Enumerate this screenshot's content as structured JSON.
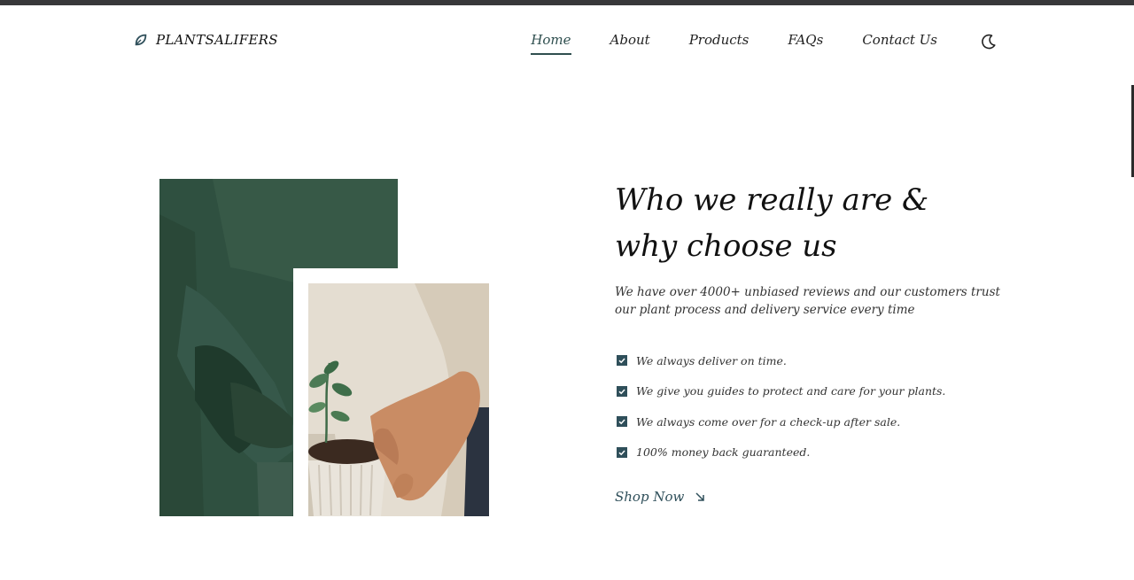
{
  "brand": {
    "name": "PLANTSALIFERS",
    "icon": "leaf-icon"
  },
  "nav": {
    "items": [
      {
        "label": "Home",
        "active": true
      },
      {
        "label": "About",
        "active": false
      },
      {
        "label": "Products",
        "active": false
      },
      {
        "label": "FAQs",
        "active": false
      },
      {
        "label": "Contact Us",
        "active": false
      }
    ],
    "theme_toggle_icon": "moon-icon"
  },
  "about": {
    "heading_line1": "Who we really are &",
    "heading_line2": "why choose us",
    "lead": "We have over 4000+ unbiased reviews and our customers trust our plant process and delivery service every time",
    "features": [
      "We always deliver on time.",
      "We give you guides to protect and care for your plants.",
      "We always come over for a check-up after sale.",
      "100% money back guaranteed."
    ],
    "cta_label": "Shop Now",
    "cta_icon": "arrow-down-right-icon"
  },
  "colors": {
    "accent": "#2f4f5a",
    "image_overlay_green": "#2d4d3d",
    "text": "#111111"
  }
}
